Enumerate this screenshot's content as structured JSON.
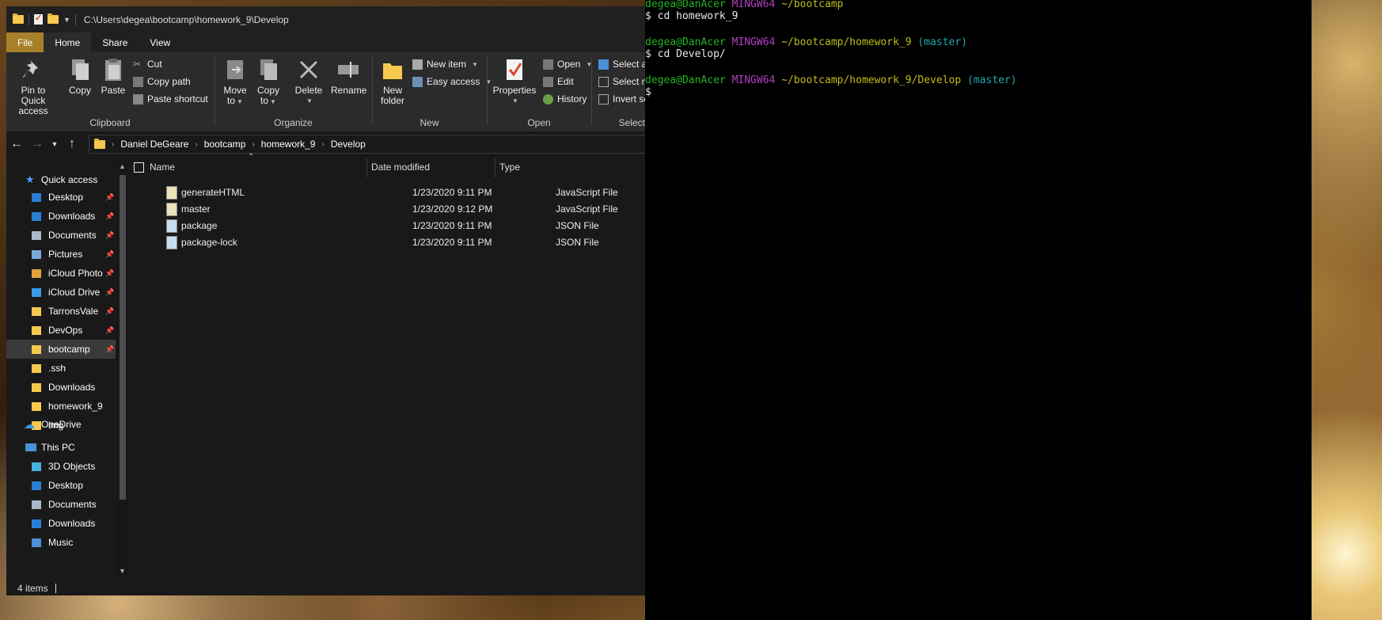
{
  "explorer": {
    "title_path": "C:\\Users\\degea\\bootcamp\\homework_9\\Develop",
    "ribbon_tabs": [
      {
        "label": "File"
      },
      {
        "label": "Home"
      },
      {
        "label": "Share"
      },
      {
        "label": "View"
      }
    ],
    "clipboard": {
      "pin_label_1": "Pin to Quick",
      "pin_label_2": "access",
      "copy": "Copy",
      "paste": "Paste",
      "cut": "Cut",
      "copy_path": "Copy path",
      "paste_shortcut": "Paste shortcut",
      "group": "Clipboard"
    },
    "organize": {
      "move_1": "Move",
      "move_2": "to",
      "copy_1": "Copy",
      "copy_2": "to",
      "delete": "Delete",
      "rename": "Rename",
      "group": "Organize"
    },
    "new": {
      "folder_1": "New",
      "folder_2": "folder",
      "new_item": "New item",
      "easy_access": "Easy access",
      "group": "New"
    },
    "open": {
      "properties": "Properties",
      "open": "Open",
      "edit": "Edit",
      "history": "History",
      "group": "Open"
    },
    "select": {
      "select_all": "Select all",
      "select_none": "Select no",
      "invert": "Invert sele",
      "group": "Select"
    },
    "breadcrumb": [
      "Daniel DeGeare",
      "bootcamp",
      "homework_9",
      "Develop"
    ],
    "nav": {
      "quick_access": "Quick access",
      "items": [
        {
          "label": "Desktop"
        },
        {
          "label": "Downloads"
        },
        {
          "label": "Documents"
        },
        {
          "label": "Pictures"
        },
        {
          "label": "iCloud Photo"
        },
        {
          "label": "iCloud Drive"
        },
        {
          "label": "TarronsVale"
        },
        {
          "label": "DevOps"
        },
        {
          "label": "bootcamp"
        },
        {
          "label": ".ssh"
        },
        {
          "label": "Downloads"
        },
        {
          "label": "homework_9"
        },
        {
          "label": "img"
        }
      ],
      "onedrive": "OneDrive",
      "this_pc": "This PC",
      "pc_items": [
        {
          "label": "3D Objects"
        },
        {
          "label": "Desktop"
        },
        {
          "label": "Documents"
        },
        {
          "label": "Downloads"
        },
        {
          "label": "Music"
        }
      ]
    },
    "columns": {
      "name": "Name",
      "date": "Date modified",
      "type": "Type"
    },
    "files": [
      {
        "name": "generateHTML",
        "date": "1/23/2020 9:11 PM",
        "type": "JavaScript File",
        "icon": "js-file-icon"
      },
      {
        "name": "master",
        "date": "1/23/2020 9:12 PM",
        "type": "JavaScript File",
        "icon": "js-file-icon"
      },
      {
        "name": "package",
        "date": "1/23/2020 9:11 PM",
        "type": "JSON File",
        "icon": "json-file-icon"
      },
      {
        "name": "package-lock",
        "date": "1/23/2020 9:11 PM",
        "type": "JSON File",
        "icon": "json-file-icon"
      }
    ],
    "status": "4 items"
  },
  "terminal": {
    "lines": [
      {
        "user": "degea@DanAcer",
        "host": "MINGW64",
        "path": "~/bootcamp",
        "branch": ""
      },
      {
        "cmd": "$ cd homework_9"
      },
      {
        "user": "degea@DanAcer",
        "host": "MINGW64",
        "path": "~/bootcamp/homework_9",
        "branch": "(master)"
      },
      {
        "cmd": "$ cd Develop/"
      },
      {
        "user": "degea@DanAcer",
        "host": "MINGW64",
        "path": "~/bootcamp/homework_9/Develop",
        "branch": "(master)"
      },
      {
        "cmd": "$"
      }
    ],
    "colors": {
      "user": "#22b422",
      "host": "#b040c0",
      "path": "#bdbd1a",
      "branch": "#20a8b0"
    }
  }
}
